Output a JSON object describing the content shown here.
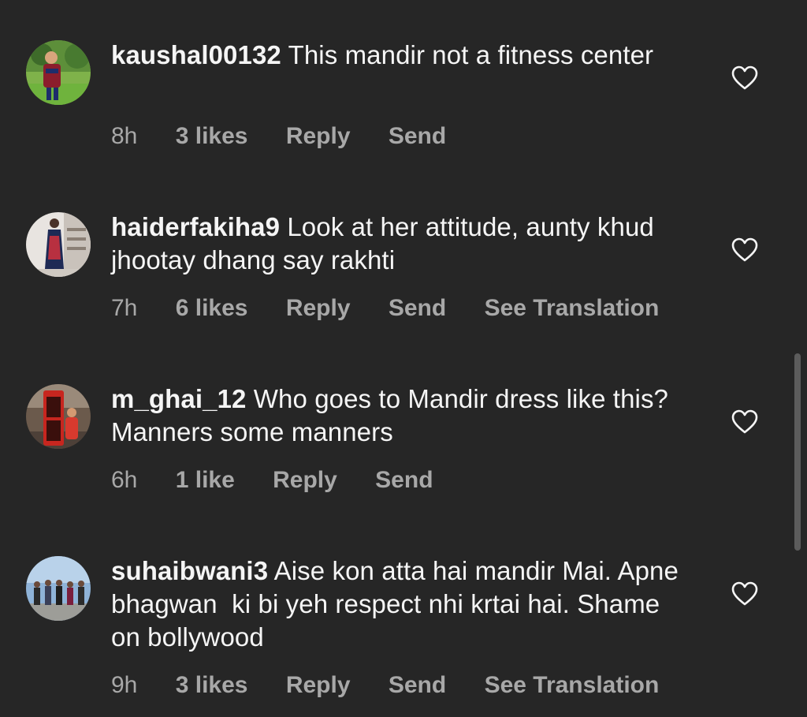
{
  "comments": [
    {
      "username": "kaushal00132",
      "text": "This mandir not a fitness center",
      "time": "8h",
      "likes": "3 likes",
      "reply": "Reply",
      "send": "Send",
      "translation": null
    },
    {
      "username": "haiderfakiha9",
      "text": "Look at her attitude, aunty khud jhootay dhang say rakhti",
      "time": "7h",
      "likes": "6 likes",
      "reply": "Reply",
      "send": "Send",
      "translation": "See Translation"
    },
    {
      "username": "m_ghai_12",
      "text": "Who goes to Mandir dress like this? Manners some manners",
      "time": "6h",
      "likes": "1 like",
      "reply": "Reply",
      "send": "Send",
      "translation": null
    },
    {
      "username": "suhaibwani3",
      "text": "Aise kon atta hai mandir Mai. Apne bhagwan  ki bi yeh respect nhi krtai hai. Shame on bollywood",
      "time": "9h",
      "likes": "3 likes",
      "reply": "Reply",
      "send": "Send",
      "translation": "See Translation"
    }
  ],
  "icons": {
    "like": "heart-outline-icon"
  },
  "colors": {
    "background": "#262626",
    "text_primary": "#f5f5f5",
    "text_secondary": "#a8a8a8",
    "scrollbar": "#5c5c5c"
  }
}
